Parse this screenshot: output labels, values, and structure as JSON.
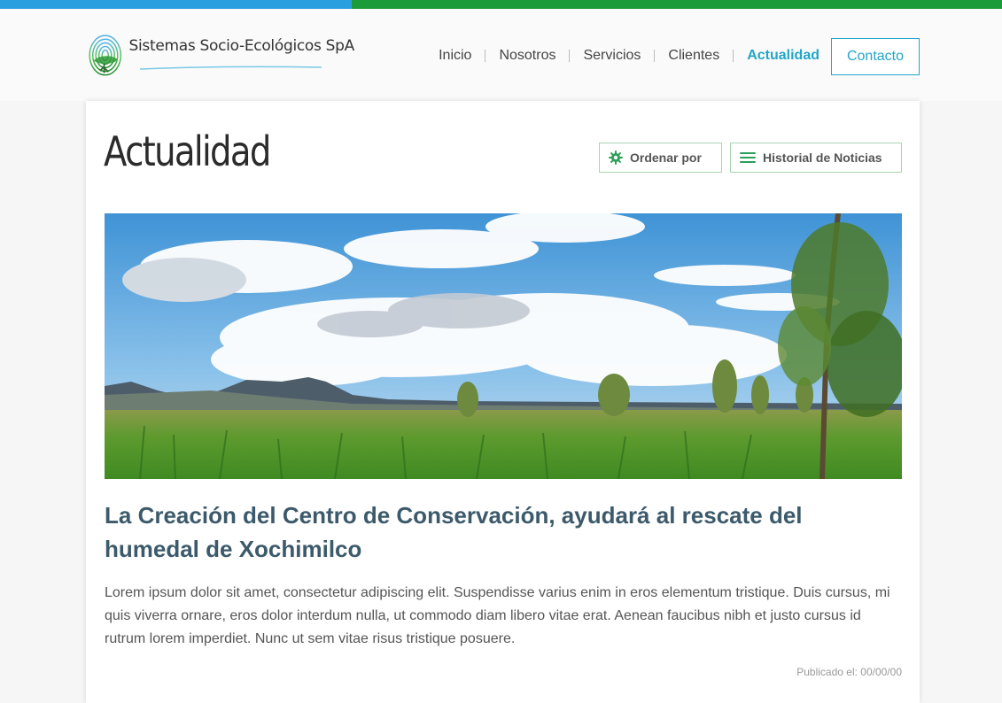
{
  "colors": {
    "top_blue": "#2a9fdf",
    "top_green": "#1c9b3a",
    "accent": "#23a6c9",
    "button_border": "#a8d4b5",
    "button_icon": "#2e9e5b",
    "title_color": "#3c5a6b"
  },
  "brand": {
    "name": "Sistemas Socio-Ecológicos SpA",
    "logo_icon": "fingerprint-tree-logo"
  },
  "nav": {
    "items": [
      {
        "label": "Inicio",
        "active": false
      },
      {
        "label": "Nosotros",
        "active": false
      },
      {
        "label": "Servicios",
        "active": false
      },
      {
        "label": "Clientes",
        "active": false
      },
      {
        "label": "Actualidad",
        "active": true
      }
    ],
    "contact_label": "Contacto"
  },
  "page": {
    "title": "Actualidad",
    "order_button": {
      "label": "Ordenar por",
      "icon": "gear-icon"
    },
    "history_button": {
      "label": "Historial de Noticias",
      "icon": "menu-icon"
    }
  },
  "article": {
    "image_icon": "wetland-landscape-photo",
    "title": "La Creación del Centro de Conservación, ayudará al rescate del humedal de Xochimilco",
    "body": "Lorem ipsum dolor sit amet, consectetur adipiscing elit. Suspendisse varius enim in eros elementum tristique. Duis cursus, mi quis viverra ornare, eros dolor interdum nulla, ut commodo diam libero vitae erat. Aenean faucibus nibh et justo cursus id rutrum lorem imperdiet. Nunc ut sem vitae risus tristique posuere.",
    "published": "Publicado el: 00/00/00"
  }
}
